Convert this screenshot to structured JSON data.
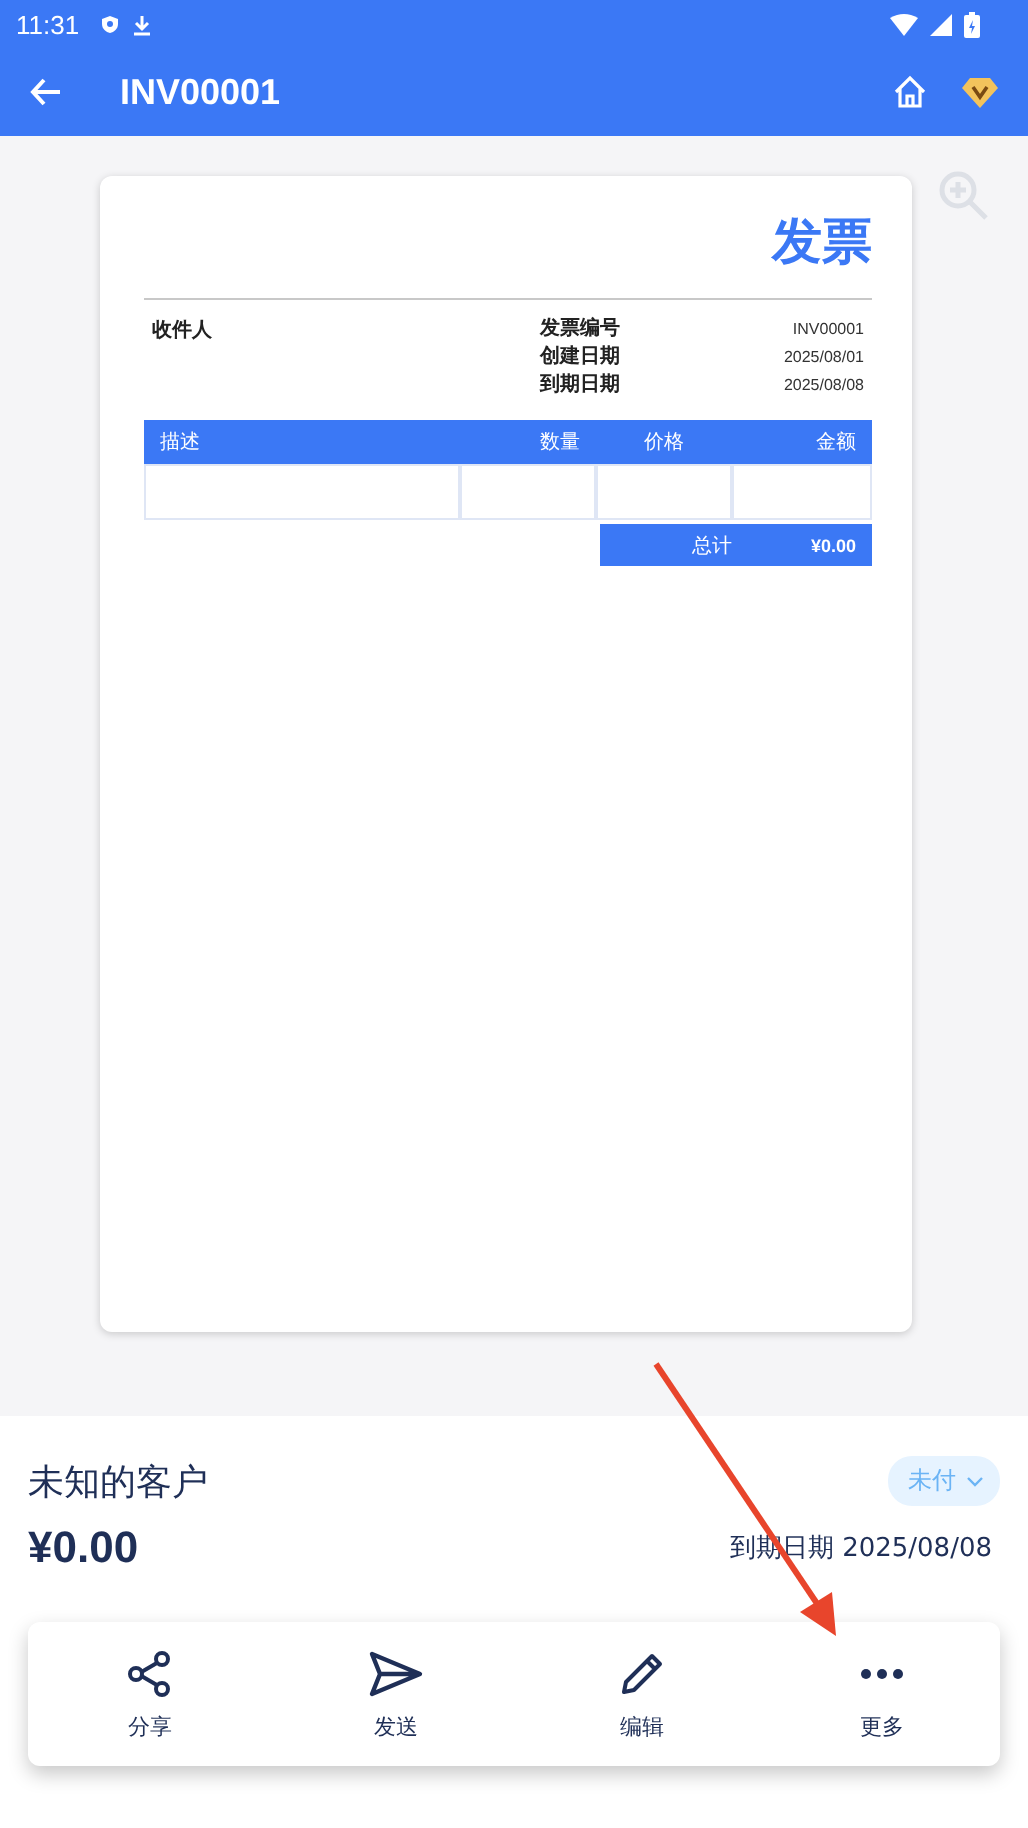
{
  "status_bar": {
    "time": "11:31"
  },
  "app_bar": {
    "title": "INV00001"
  },
  "invoice": {
    "heading": "发票",
    "recipient_label": "收件人",
    "meta": [
      {
        "label": "发票编号",
        "value": "INV00001"
      },
      {
        "label": "创建日期",
        "value": "2025/08/01"
      },
      {
        "label": "到期日期",
        "value": "2025/08/08"
      }
    ],
    "columns": [
      "描述",
      "数量",
      "价格",
      "金额"
    ],
    "total_label": "总计",
    "total_value": "¥0.00"
  },
  "summary": {
    "client": "未知的客户",
    "status": "未付",
    "amount": "¥0.00",
    "due": "到期日期 2025/08/08"
  },
  "actions": [
    {
      "kind": "share",
      "label": "分享"
    },
    {
      "kind": "send",
      "label": "发送"
    },
    {
      "kind": "edit",
      "label": "编辑"
    },
    {
      "kind": "more",
      "label": "更多"
    }
  ]
}
